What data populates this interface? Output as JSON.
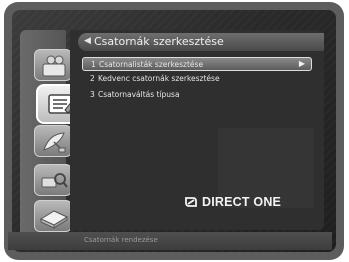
{
  "header": {
    "title": "Csatornák szerkesztése"
  },
  "menu": {
    "items": [
      {
        "number": "1",
        "label": "Csatornalisták szerkesztése",
        "selected": true
      },
      {
        "number": "2",
        "label": "Kedvenc csatornák szerkesztése",
        "selected": false
      },
      {
        "number": "3",
        "label": "Csatornaváltás típusa",
        "selected": false
      }
    ]
  },
  "sidebar": {
    "icons": [
      {
        "name": "installation-icon",
        "active": false
      },
      {
        "name": "channel-edit-icon",
        "active": true
      },
      {
        "name": "satellite-icon",
        "active": false
      },
      {
        "name": "search-icon",
        "active": false
      },
      {
        "name": "system-icon",
        "active": false
      }
    ]
  },
  "brand": {
    "name": "DIRECT ONE"
  },
  "footer": {
    "hint": "Csatornák rendezése"
  },
  "colors": {
    "accent": "#e6e6e6",
    "panel": "#2f2f2f",
    "background": "#2a2a2a"
  }
}
